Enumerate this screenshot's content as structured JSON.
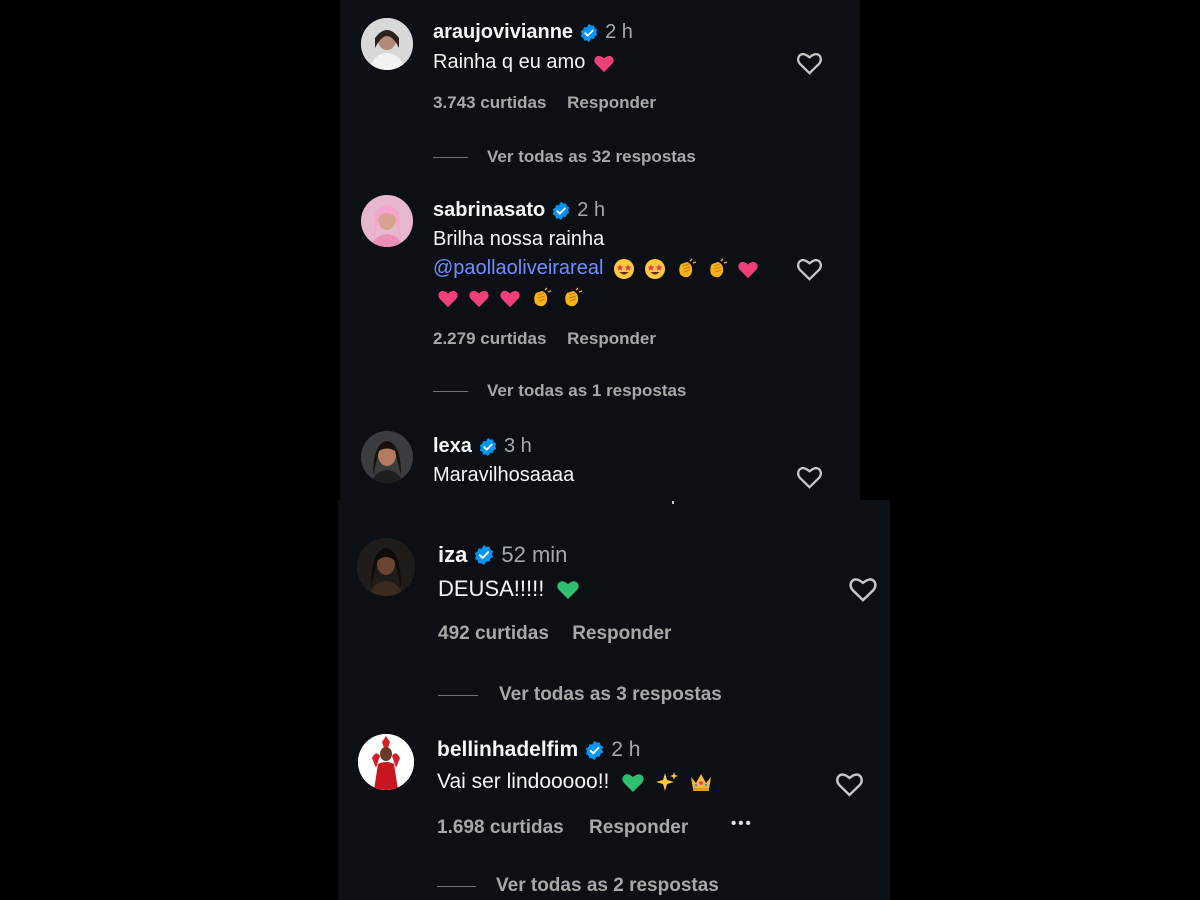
{
  "comments": [
    {
      "username": "araujovivianne",
      "time": "2 h",
      "text": "Rainha q eu amo",
      "likes": "3.743 curtidas",
      "reply": "Responder",
      "view_replies": "Ver todas as 32 respostas"
    },
    {
      "username": "sabrinasato",
      "time": "2 h",
      "text_line1": "Brilha nossa rainha",
      "mention": "@paollaoliveirareal",
      "likes": "2.279 curtidas",
      "reply": "Responder",
      "view_replies": "Ver todas as 1 respostas"
    },
    {
      "username": "lexa",
      "time": "3 h",
      "text": "Maravilhosaaaa"
    },
    {
      "username": "iza",
      "time": "52 min",
      "text": "DEUSA!!!!!",
      "likes": "492 curtidas",
      "reply": "Responder",
      "view_replies": "Ver todas as 3 respostas"
    },
    {
      "username": "bellinhadelfim",
      "time": "2 h",
      "text": "Vai ser lindooooo!!",
      "likes": "1.698 curtidas",
      "reply": "Responder",
      "more": "•••",
      "view_replies": "Ver todas as 2 respostas"
    }
  ],
  "colors": {
    "background": "#000000",
    "panel": "#0c0f14",
    "primary_text": "#f5f5f5",
    "secondary_text": "#a8a8a8",
    "verified": "#0095f6",
    "mention": "#6f8fff"
  }
}
